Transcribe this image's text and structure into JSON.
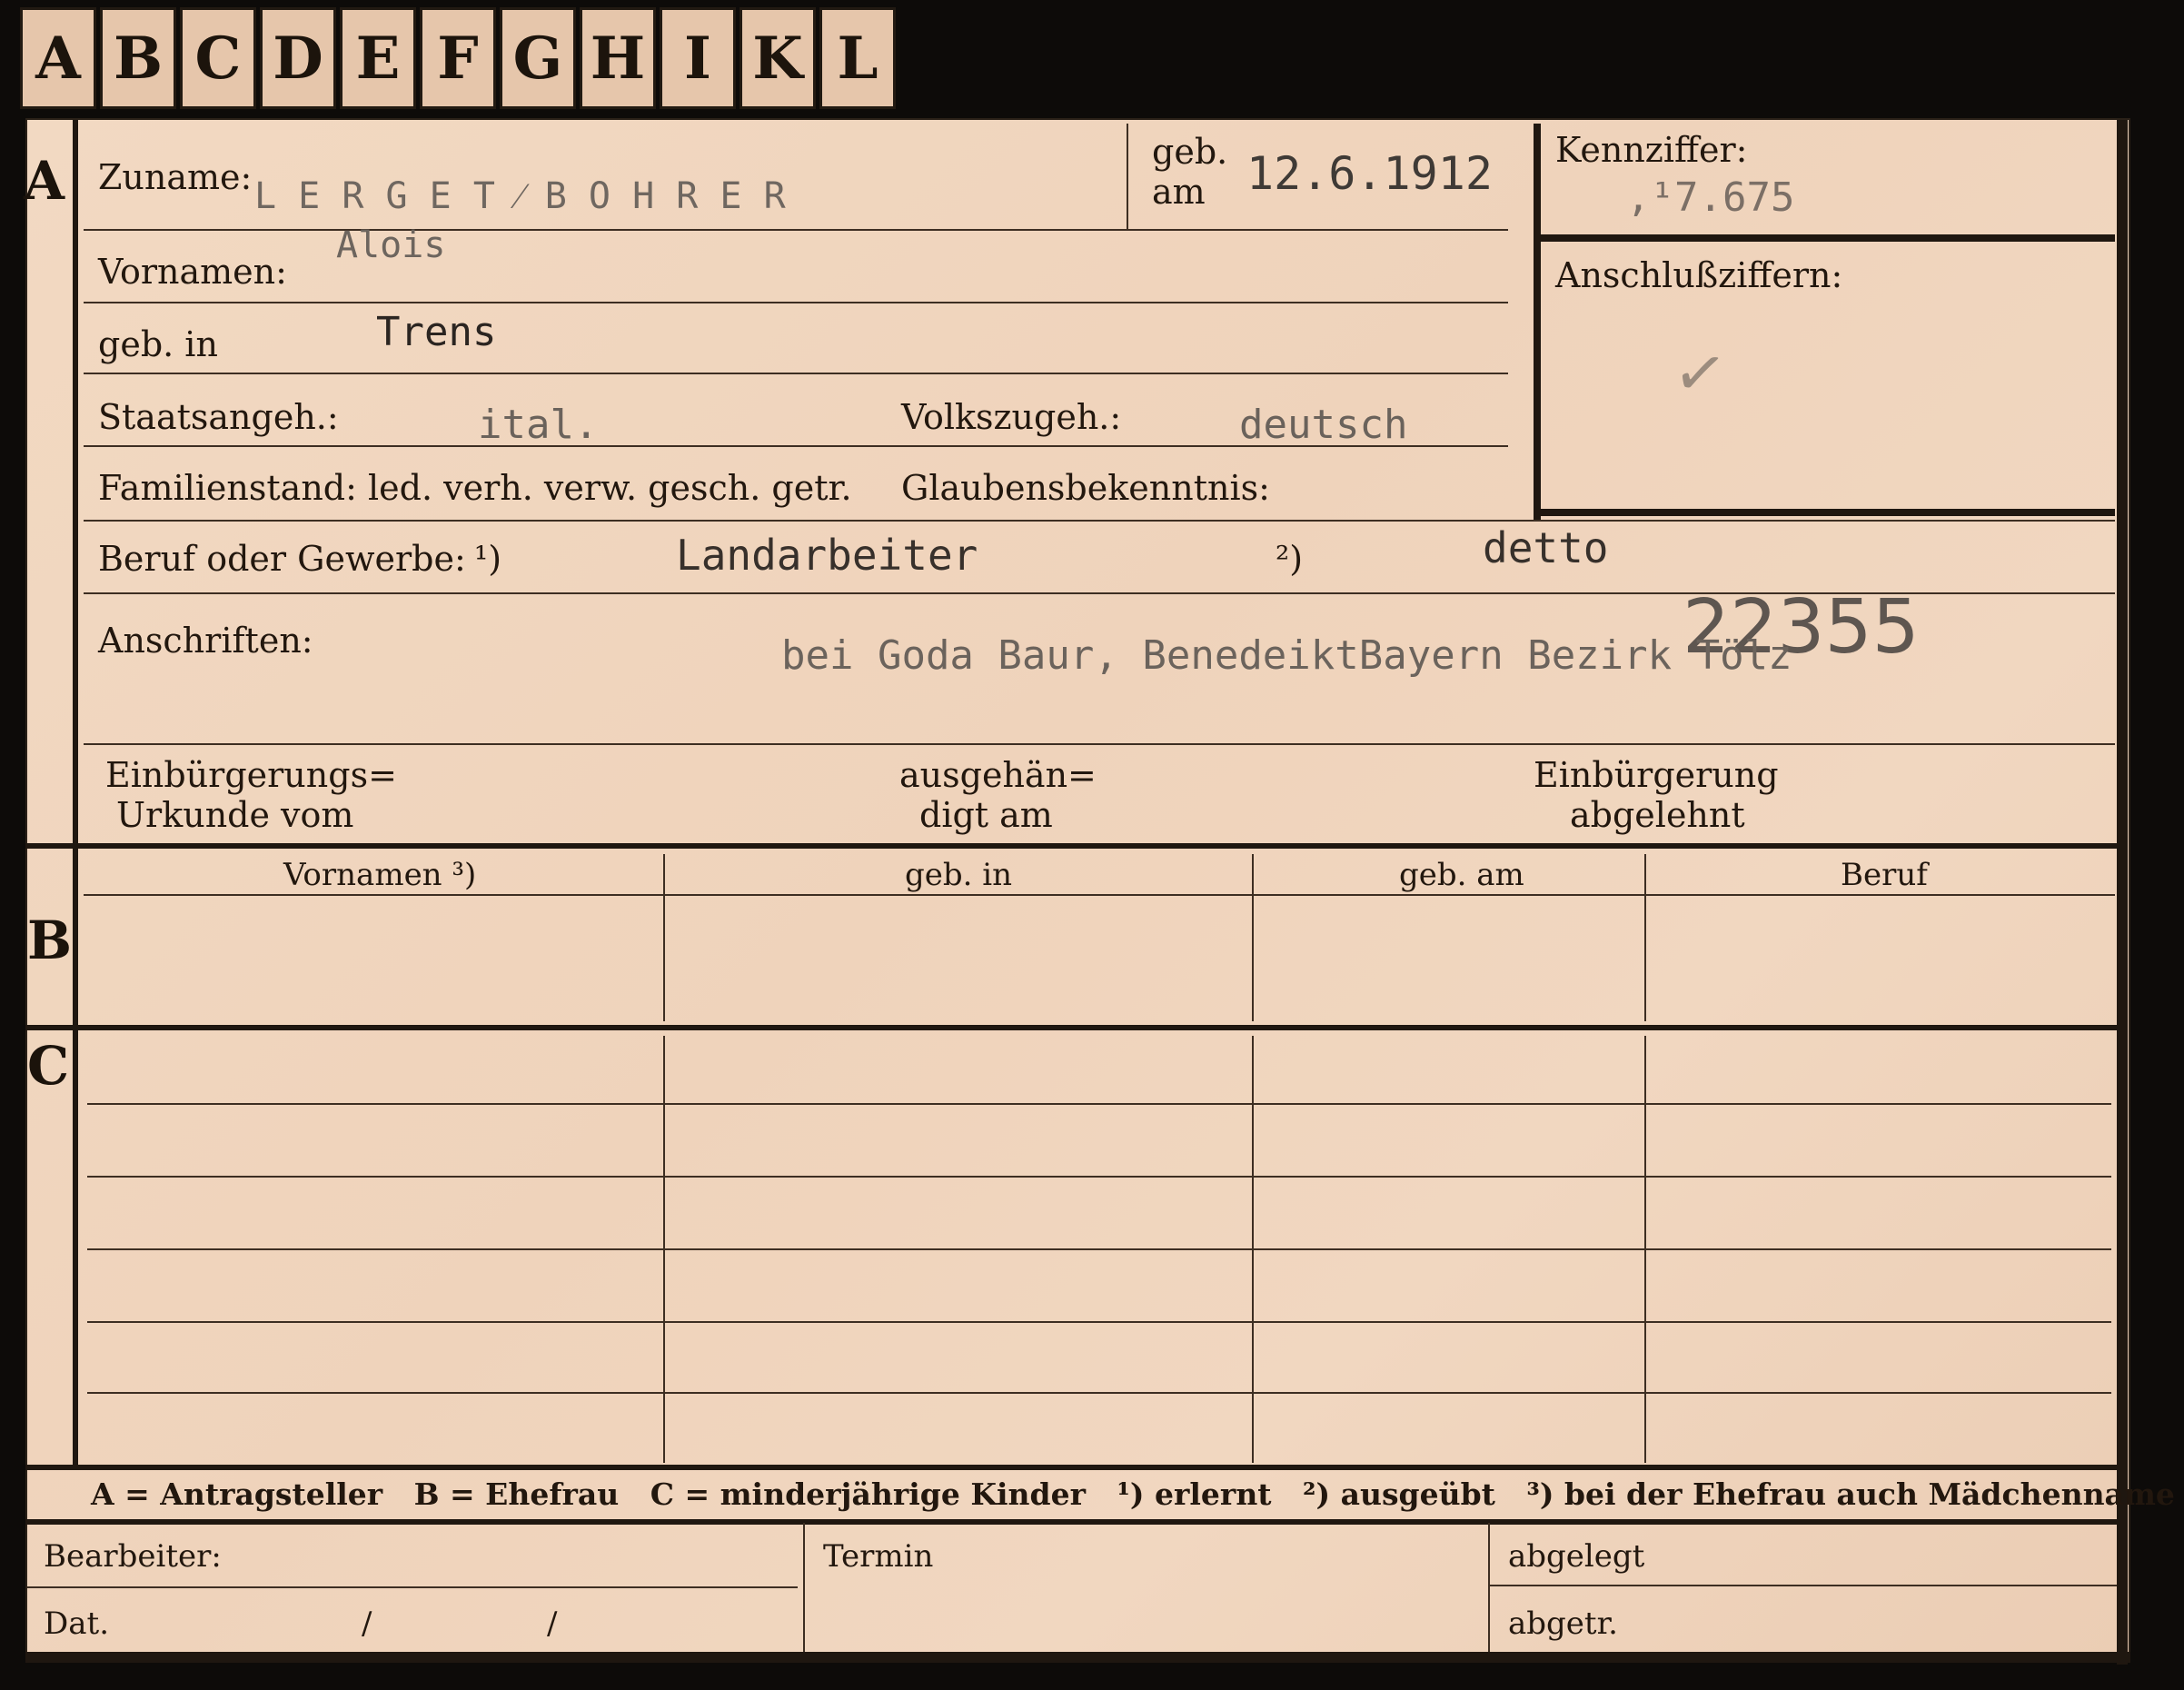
{
  "tabs": [
    "A",
    "B",
    "C",
    "D",
    "E",
    "F",
    "G",
    "H",
    "I",
    "K",
    "L"
  ],
  "sections": {
    "a": "A",
    "b": "B",
    "c": "C"
  },
  "labels": {
    "zuname": "Zuname:",
    "geb_am_1": "geb.",
    "geb_am_2": "am",
    "kennziffer": "Kennziffer:",
    "vornamen": "Vornamen:",
    "anschlussziffern": "Anschlußziffern:",
    "geb_in": "geb. in",
    "staatsangeh": "Staatsangeh.:",
    "volkszugeh": "Volkszugeh.:",
    "familienstand": "Familienstand: led. verh. verw. gesch. getr.",
    "glaubensbekenntnis": "Glaubensbekenntnis:",
    "beruf": "Beruf oder Gewerbe:",
    "beruf_mark1": "¹)",
    "beruf_mark2": "²)",
    "anschriften": "Anschriften:",
    "einbuergerungs_1": "Einbürgerungs=",
    "einbuergerungs_2": "Urkunde vom",
    "ausgehaen_1": "ausgehän=",
    "ausgehaen_2": "digt am",
    "einbuergerung_1": "Einbürgerung",
    "einbuergerung_2": "abgelehnt"
  },
  "values": {
    "zuname": "L E R G E T ⁄ B O H R E R",
    "geb_am": "12.6.1912",
    "kennziffer": "‚¹7.675",
    "vornamen": "Alois",
    "geb_in": "Trens",
    "staatsangeh": "ital.",
    "volkszugeh": "deutsch",
    "beruf_erlernt": "Landarbeiter",
    "beruf_ausgeuebt": "detto",
    "anschrift": "bei Goda Baur, BenedeiktBayern Bezirk Tölz",
    "stamp_number": "22355",
    "checkmark": "✓"
  },
  "table_headers": [
    "Vornamen ³)",
    "geb. in",
    "geb. am",
    "Beruf"
  ],
  "legend": "A = Antragsteller   B = Ehefrau   C = minderjährige Kinder   ¹) erlernt   ²) ausgeübt   ³) bei der Ehefrau auch Mädchenname",
  "footer": {
    "bearbeiter": "Bearbeiter:",
    "dat": "Dat.",
    "slash1": "/",
    "slash2": "/",
    "termin": "Termin",
    "abgelegt": "abgelegt",
    "abgetr": "abgetr."
  }
}
